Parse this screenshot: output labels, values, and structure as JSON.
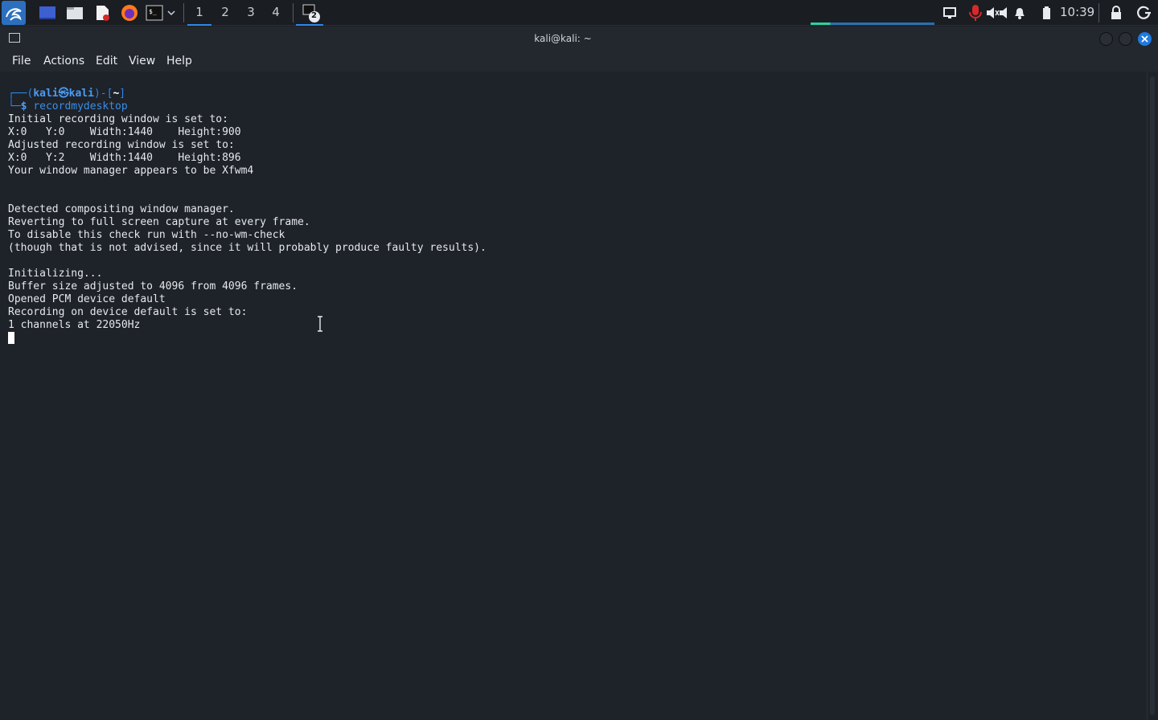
{
  "panel": {
    "workspaces": [
      "1",
      "2",
      "3",
      "4"
    ],
    "active_workspace": "1",
    "task_badge": "2",
    "clock": "10:39",
    "launchers": [
      "kali-menu-icon",
      "desktop-icon",
      "file-manager-icon",
      "text-editor-icon",
      "firefox-icon",
      "terminal-icon"
    ]
  },
  "window": {
    "title": "kali@kali: ~",
    "menu": [
      "File",
      "Actions",
      "Edit",
      "View",
      "Help"
    ]
  },
  "terminal": {
    "prompt_user": "kali",
    "prompt_host": "kali",
    "prompt_dir": "~",
    "command": "recordmydesktop",
    "output": [
      "Initial recording window is set to:",
      "X:0   Y:0    Width:1440    Height:900",
      "Adjusted recording window is set to:",
      "X:0   Y:2    Width:1440    Height:896",
      "Your window manager appears to be Xfwm4",
      "",
      "",
      "Detected compositing window manager.",
      "Reverting to full screen capture at every frame.",
      "To disable this check run with --no-wm-check",
      "(though that is not advised, since it will probably produce faulty results).",
      "",
      "Initializing...",
      "Buffer size adjusted to 4096 from 4096 frames.",
      "Opened PCM device default",
      "Recording on device default is set to:",
      "1 channels at 22050Hz"
    ]
  },
  "colors": {
    "accent": "#2f86e8",
    "background": "#1e2229",
    "text": "#e6e8eb"
  }
}
